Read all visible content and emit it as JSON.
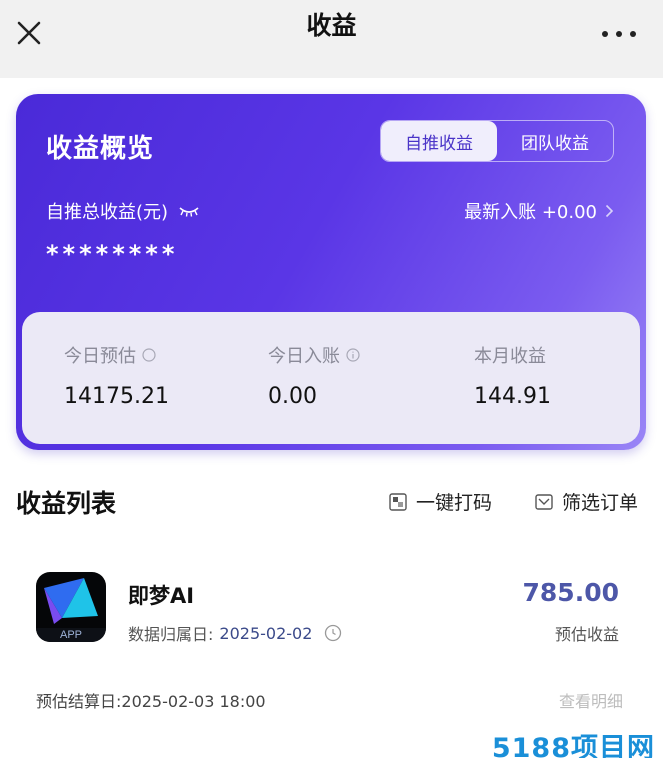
{
  "header": {
    "title": "收益",
    "close_icon": "close-icon",
    "more_icon": "more-icon"
  },
  "overview": {
    "title": "收益概览",
    "tabs": [
      {
        "label": "自推收益",
        "active": true
      },
      {
        "label": "团队收益",
        "active": false
      }
    ],
    "total_label": "自推总收益(元)",
    "latest_label": "最新入账 +0.00",
    "masked_total": "********",
    "stats": [
      {
        "label": "今日预估",
        "value": "14175.21"
      },
      {
        "label": "今日入账",
        "value": "0.00"
      },
      {
        "label": "本月收益",
        "value": "144.91"
      }
    ],
    "colors": {
      "card_start": "#4a2ad8",
      "card_end": "#9a86f6"
    }
  },
  "list": {
    "title": "收益列表",
    "tools": [
      {
        "label": "一键打码",
        "icon": "mosaic-icon"
      },
      {
        "label": "筛选订单",
        "icon": "filter-icon"
      }
    ],
    "items": [
      {
        "app_name": "即梦AI",
        "logo_text": "APP",
        "date_label": "数据归属日:",
        "date_value": "2025-02-02",
        "amount": "785.00",
        "amount_label": "预估收益",
        "settle_text": "预估结算日:2025-02-03 18:00",
        "detail_label": "查看明细"
      }
    ]
  },
  "watermark": "5188项目网"
}
